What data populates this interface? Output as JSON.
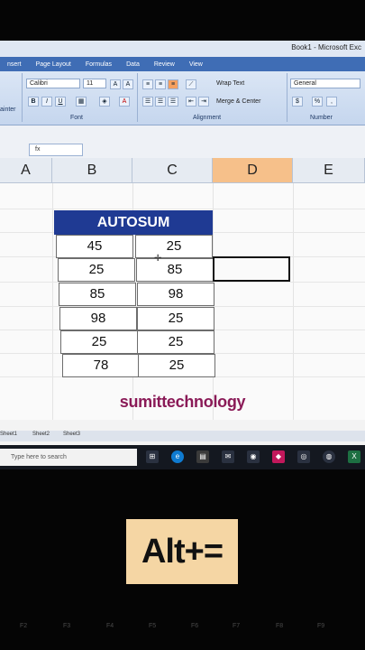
{
  "window": {
    "title": "Book1 - Microsoft Exc"
  },
  "ribbon_tabs": [
    "nsert",
    "Page Layout",
    "Formulas",
    "Data",
    "Review",
    "View"
  ],
  "ribbon": {
    "font_name": "Calibri",
    "font_size": "11",
    "wrap_text": "Wrap Text",
    "merge_center": "Merge & Center",
    "number_format": "General",
    "group_painter": "ainter",
    "group_font": "Font",
    "group_alignment": "Alignment",
    "group_number": "Number",
    "bold": "B",
    "italic": "I",
    "underline": "U",
    "grow_font": "A",
    "shrink_font": "A",
    "currency": "$",
    "percent": "%"
  },
  "formula_bar": {
    "fx_label": "fx"
  },
  "columns": [
    "A",
    "B",
    "C",
    "D",
    "E"
  ],
  "table": {
    "header": "AUTOSUM",
    "rows": [
      [
        "45",
        "25"
      ],
      [
        "25",
        "85"
      ],
      [
        "85",
        "98"
      ],
      [
        "98",
        "25"
      ],
      [
        "25",
        "25"
      ],
      [
        "78",
        "25"
      ]
    ]
  },
  "watermark": "sumittechnology",
  "sheets": [
    "Sheet1",
    "Sheet2",
    "Sheet3"
  ],
  "taskbar": {
    "search_placeholder": "Type here to search"
  },
  "caption": "Alt+=",
  "fkeys": [
    "F2",
    "F3",
    "F4",
    "F5",
    "F6",
    "F7",
    "F8",
    "F9"
  ]
}
